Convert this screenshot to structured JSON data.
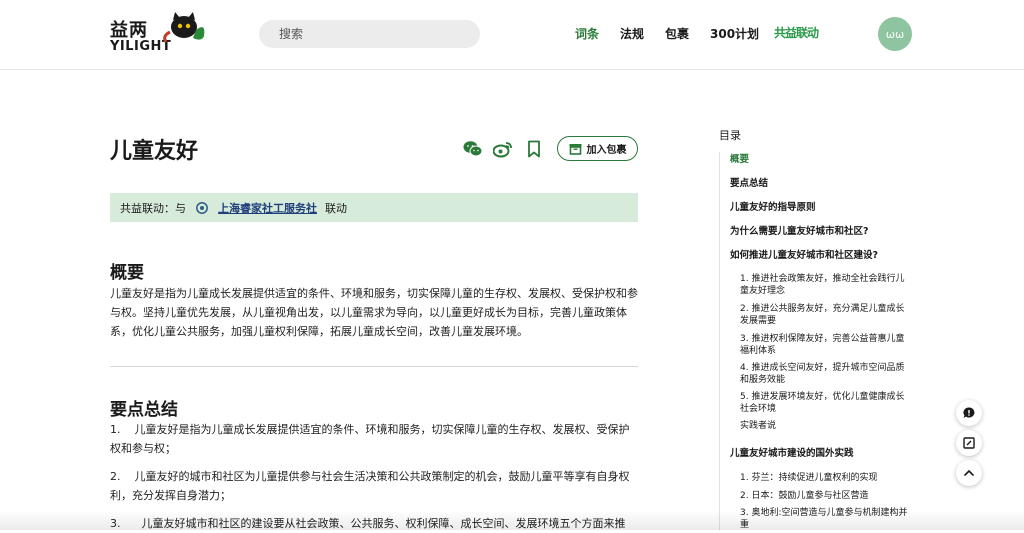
{
  "header": {
    "logo_cn": "益两",
    "logo_en": "YILIGHT",
    "search_placeholder": "搜索",
    "nav": [
      "词条",
      "法规",
      "包裹",
      "300计划"
    ],
    "nav_active_index": 0,
    "partner_logo_text": "共益联动",
    "avatar_text": "ωω"
  },
  "article": {
    "title": "儿童友好",
    "add_button_label": "加入包裹",
    "coop_prefix": "共益联动：与",
    "coop_org": "上海睿家社工服务社",
    "coop_suffix": "联动",
    "sections": [
      {
        "heading": "概要",
        "paragraphs": [
          "儿童友好是指为儿童成长发展提供适宜的条件、环境和服务，切实保障儿童的生存权、发展权、受保护权和参与权。坚持儿童优先发展，从儿童视角出发，以儿童需求为导向，以儿童更好成长为目标，完善儿童政策体系，优化儿童公共服务，加强儿童权利保障，拓展儿童成长空间，改善儿童发展环境。"
        ]
      },
      {
        "heading": "要点总结",
        "paragraphs": [
          "1.    儿童友好是指为儿童成长发展提供适宜的条件、环境和服务，切实保障儿童的生存权、发展权、受保护权和参与权；",
          "2.    儿童友好的城市和社区为儿童提供参与社会生活决策和公共政策制定的机会，鼓励儿童平等享有自身权利，充分发挥自身潜力；",
          "3.      儿童友好城市和社区的建设要从社会政策、公共服务、权利保障、成长空间、发展环境五个方面来推"
        ]
      }
    ]
  },
  "toc": {
    "title": "目录",
    "items": [
      {
        "label": "概要",
        "level": 1,
        "active": true
      },
      {
        "label": "要点总结",
        "level": 1
      },
      {
        "label": "儿童友好的指导原则",
        "level": 1
      },
      {
        "label": "为什么需要儿童友好城市和社区?",
        "level": 1
      },
      {
        "label": "如何推进儿童友好城市和社区建设?",
        "level": 1
      },
      {
        "label": "1. 推进社会政策友好，推动全社会践行儿童友好理念",
        "level": 2
      },
      {
        "label": "2. 推进公共服务友好，充分满足儿童成长发展需要",
        "level": 2
      },
      {
        "label": "3. 推进权利保障友好，完善公益普惠儿童福利体系",
        "level": 2
      },
      {
        "label": "4. 推进成长空间友好，提升城市空间品质和服务效能",
        "level": 2
      },
      {
        "label": "5. 推进发展环境友好，优化儿童健康成长社会环境",
        "level": 2
      },
      {
        "label": "实践者说",
        "level": 2
      },
      {
        "label": "儿童友好城市建设的国外实践",
        "level": 1
      },
      {
        "label": "1. 芬兰：持续促进儿童权利的实现",
        "level": 2
      },
      {
        "label": "2. 日本：鼓励儿童参与社区营造",
        "level": 2
      },
      {
        "label": "3. 奥地利:空间营造与儿童参与机制建构并重",
        "level": 2
      }
    ]
  },
  "colors": {
    "accent": "#2a7a3a",
    "coop_bg": "#d7ebdb"
  },
  "icons": [
    "wechat-icon",
    "weibo-icon",
    "bookmark-icon",
    "package-icon",
    "comment-icon",
    "edit-icon",
    "arrow-up-icon"
  ]
}
